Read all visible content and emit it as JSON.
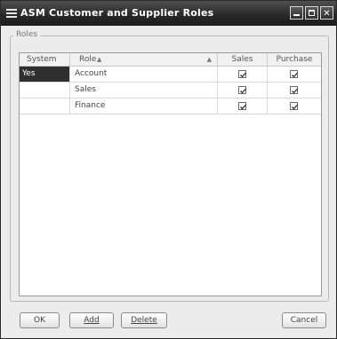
{
  "window": {
    "title": "ASM   Customer and Supplier Roles"
  },
  "group": {
    "label": "Roles"
  },
  "grid": {
    "columns": {
      "system": "System",
      "role": "Role",
      "sales": "Sales",
      "purchase": "Purchase"
    },
    "rows": [
      {
        "system": "Yes",
        "role": "Account",
        "sales": true,
        "purchase": true
      },
      {
        "system": "",
        "role": "Sales",
        "sales": true,
        "purchase": true
      },
      {
        "system": "",
        "role": "Finance",
        "sales": true,
        "purchase": true
      }
    ]
  },
  "buttons": {
    "ok": "OK",
    "add": "Add",
    "delete": "Delete",
    "cancel": "Cancel"
  },
  "icons": {
    "system_menu": "menu-icon",
    "minimize": "minimize-icon",
    "maximize": "maximize-icon",
    "close": "close-icon",
    "sort": "sort-ascending-icon",
    "check": "check-icon"
  },
  "colors": {
    "titlebar": "#2a2a2a",
    "selection": "#2f2f2f"
  }
}
